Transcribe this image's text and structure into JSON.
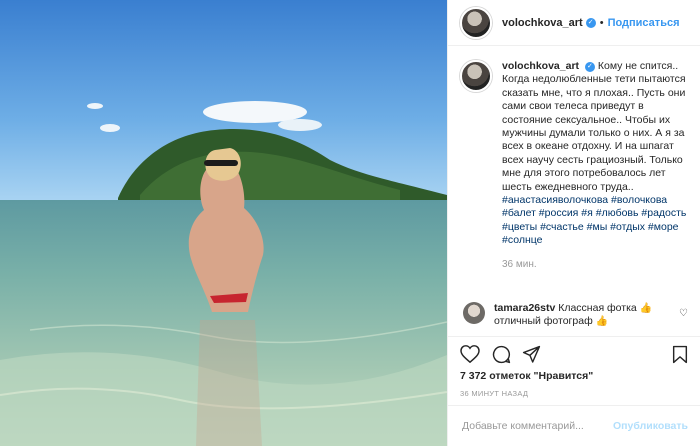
{
  "post": {
    "username": "volochkova_art",
    "follow_label": "Подписаться",
    "separator": "•",
    "verified_icon": "verified-badge-icon",
    "caption_username": "volochkova_art",
    "caption_line1": "Кому не спится..",
    "caption_body": "Когда недолюбленные тети пытаются сказать мне, что я плохая.. Пусть они сами свои телеса приведут в состояние сексуальное.. Чтобы их мужчины думали только о них. А я за всех в океане отдохну. И на шпагат всех научу сесть грациозный. Только мне для этого потребовалось лет шесть ежедневного труда..",
    "hashtags": "#анастасияволочкова #волочкова #балет #россия #я #любовь #радость #цветы #счастье #мы #отдых #море #солнце",
    "caption_time": "36 мин.",
    "comment": {
      "username": "tamara26stv",
      "text": "Классная фотка",
      "text2": "отличный фотограф",
      "emoji": "👍"
    },
    "likes_text": "7 372 отметок \"Нравится\"",
    "ago_text": "36 МИНУТ НАЗАД",
    "comment_placeholder": "Добавьте комментарий...",
    "publish_label": "Опубликовать"
  },
  "colors": {
    "accent": "#3897f0",
    "hashtag": "#003569",
    "muted": "#999999"
  }
}
